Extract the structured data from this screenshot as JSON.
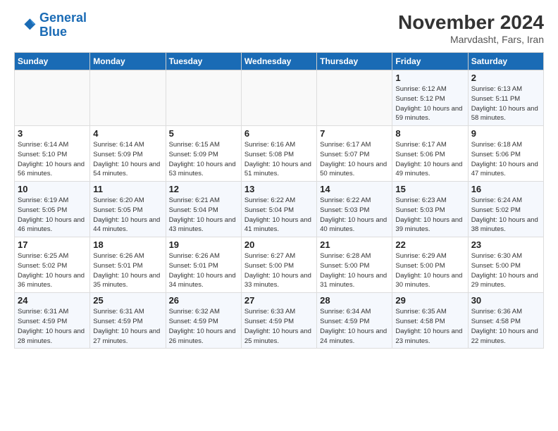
{
  "header": {
    "logo_line1": "General",
    "logo_line2": "Blue",
    "month": "November 2024",
    "location": "Marvdasht, Fars, Iran"
  },
  "weekdays": [
    "Sunday",
    "Monday",
    "Tuesday",
    "Wednesday",
    "Thursday",
    "Friday",
    "Saturday"
  ],
  "weeks": [
    [
      {
        "day": "",
        "info": ""
      },
      {
        "day": "",
        "info": ""
      },
      {
        "day": "",
        "info": ""
      },
      {
        "day": "",
        "info": ""
      },
      {
        "day": "",
        "info": ""
      },
      {
        "day": "1",
        "info": "Sunrise: 6:12 AM\nSunset: 5:12 PM\nDaylight: 10 hours and 59 minutes."
      },
      {
        "day": "2",
        "info": "Sunrise: 6:13 AM\nSunset: 5:11 PM\nDaylight: 10 hours and 58 minutes."
      }
    ],
    [
      {
        "day": "3",
        "info": "Sunrise: 6:14 AM\nSunset: 5:10 PM\nDaylight: 10 hours and 56 minutes."
      },
      {
        "day": "4",
        "info": "Sunrise: 6:14 AM\nSunset: 5:09 PM\nDaylight: 10 hours and 54 minutes."
      },
      {
        "day": "5",
        "info": "Sunrise: 6:15 AM\nSunset: 5:09 PM\nDaylight: 10 hours and 53 minutes."
      },
      {
        "day": "6",
        "info": "Sunrise: 6:16 AM\nSunset: 5:08 PM\nDaylight: 10 hours and 51 minutes."
      },
      {
        "day": "7",
        "info": "Sunrise: 6:17 AM\nSunset: 5:07 PM\nDaylight: 10 hours and 50 minutes."
      },
      {
        "day": "8",
        "info": "Sunrise: 6:17 AM\nSunset: 5:06 PM\nDaylight: 10 hours and 49 minutes."
      },
      {
        "day": "9",
        "info": "Sunrise: 6:18 AM\nSunset: 5:06 PM\nDaylight: 10 hours and 47 minutes."
      }
    ],
    [
      {
        "day": "10",
        "info": "Sunrise: 6:19 AM\nSunset: 5:05 PM\nDaylight: 10 hours and 46 minutes."
      },
      {
        "day": "11",
        "info": "Sunrise: 6:20 AM\nSunset: 5:05 PM\nDaylight: 10 hours and 44 minutes."
      },
      {
        "day": "12",
        "info": "Sunrise: 6:21 AM\nSunset: 5:04 PM\nDaylight: 10 hours and 43 minutes."
      },
      {
        "day": "13",
        "info": "Sunrise: 6:22 AM\nSunset: 5:04 PM\nDaylight: 10 hours and 41 minutes."
      },
      {
        "day": "14",
        "info": "Sunrise: 6:22 AM\nSunset: 5:03 PM\nDaylight: 10 hours and 40 minutes."
      },
      {
        "day": "15",
        "info": "Sunrise: 6:23 AM\nSunset: 5:03 PM\nDaylight: 10 hours and 39 minutes."
      },
      {
        "day": "16",
        "info": "Sunrise: 6:24 AM\nSunset: 5:02 PM\nDaylight: 10 hours and 38 minutes."
      }
    ],
    [
      {
        "day": "17",
        "info": "Sunrise: 6:25 AM\nSunset: 5:02 PM\nDaylight: 10 hours and 36 minutes."
      },
      {
        "day": "18",
        "info": "Sunrise: 6:26 AM\nSunset: 5:01 PM\nDaylight: 10 hours and 35 minutes."
      },
      {
        "day": "19",
        "info": "Sunrise: 6:26 AM\nSunset: 5:01 PM\nDaylight: 10 hours and 34 minutes."
      },
      {
        "day": "20",
        "info": "Sunrise: 6:27 AM\nSunset: 5:00 PM\nDaylight: 10 hours and 33 minutes."
      },
      {
        "day": "21",
        "info": "Sunrise: 6:28 AM\nSunset: 5:00 PM\nDaylight: 10 hours and 31 minutes."
      },
      {
        "day": "22",
        "info": "Sunrise: 6:29 AM\nSunset: 5:00 PM\nDaylight: 10 hours and 30 minutes."
      },
      {
        "day": "23",
        "info": "Sunrise: 6:30 AM\nSunset: 5:00 PM\nDaylight: 10 hours and 29 minutes."
      }
    ],
    [
      {
        "day": "24",
        "info": "Sunrise: 6:31 AM\nSunset: 4:59 PM\nDaylight: 10 hours and 28 minutes."
      },
      {
        "day": "25",
        "info": "Sunrise: 6:31 AM\nSunset: 4:59 PM\nDaylight: 10 hours and 27 minutes."
      },
      {
        "day": "26",
        "info": "Sunrise: 6:32 AM\nSunset: 4:59 PM\nDaylight: 10 hours and 26 minutes."
      },
      {
        "day": "27",
        "info": "Sunrise: 6:33 AM\nSunset: 4:59 PM\nDaylight: 10 hours and 25 minutes."
      },
      {
        "day": "28",
        "info": "Sunrise: 6:34 AM\nSunset: 4:59 PM\nDaylight: 10 hours and 24 minutes."
      },
      {
        "day": "29",
        "info": "Sunrise: 6:35 AM\nSunset: 4:58 PM\nDaylight: 10 hours and 23 minutes."
      },
      {
        "day": "30",
        "info": "Sunrise: 6:36 AM\nSunset: 4:58 PM\nDaylight: 10 hours and 22 minutes."
      }
    ]
  ]
}
